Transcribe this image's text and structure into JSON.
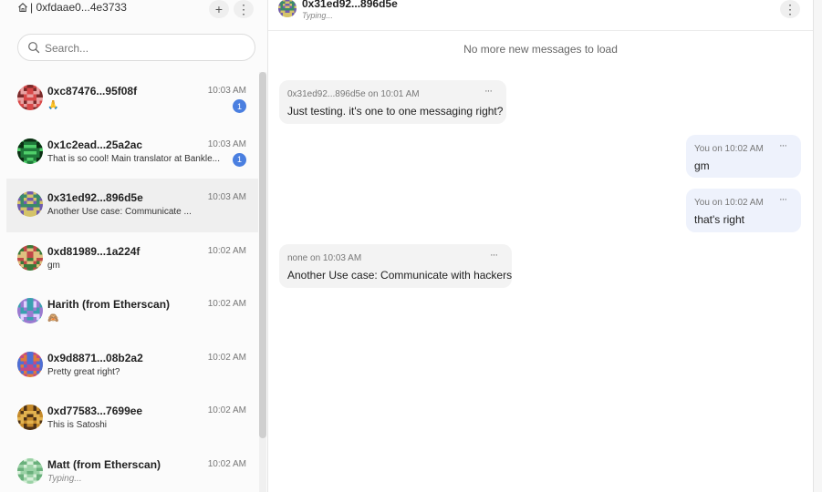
{
  "sidebar": {
    "account": "| 0xfdaae0...4e3733",
    "icons": {
      "home": "home-icon",
      "new": "plus-icon",
      "menu": "kebab-menu-icon"
    },
    "new_label": "+",
    "menu_label": "⋮",
    "search_placeholder": "Search...",
    "conversations": [
      {
        "name": "0xc87476...95f08f",
        "preview": "🙏",
        "time": "10:03 AM",
        "unread": "1"
      },
      {
        "name": "0x1c2ead...25a2ac",
        "preview": "That is so cool! Main translator at Bankle...",
        "time": "10:03 AM",
        "unread": "1"
      },
      {
        "name": "0x31ed92...896d5e",
        "preview": "Another Use case: Communicate ...",
        "time": "10:03 AM",
        "active": true
      },
      {
        "name": "0xd81989...1a224f",
        "preview": "gm",
        "time": "10:02 AM"
      },
      {
        "name": "Harith (from Etherscan)",
        "preview": "🙈",
        "time": "10:02 AM"
      },
      {
        "name": "0x9d8871...08b2a2",
        "preview": "Pretty great right?",
        "time": "10:02 AM"
      },
      {
        "name": "0xd77583...7699ee",
        "preview": "This is Satoshi",
        "time": "10:02 AM"
      },
      {
        "name": "Matt (from Etherscan)",
        "preview": "Typing...",
        "time": "10:02 AM"
      }
    ]
  },
  "chat": {
    "header_name": "0x31ed92...896d5e",
    "header_status": "Typing...",
    "menu_label": "⋮",
    "no_more_text": "No more new messages to load",
    "messages": [
      {
        "direction": "in",
        "meta": "0x31ed92...896d5e on 10:01 AM",
        "text": "Just testing. it's one to one messaging right?",
        "more": "···"
      },
      {
        "direction": "out",
        "meta": "You on 10:02 AM",
        "text": "gm",
        "more": "···"
      },
      {
        "direction": "out",
        "meta": "You on 10:02 AM",
        "text": "that's right",
        "more": "···"
      },
      {
        "direction": "in",
        "meta": "none on 10:03 AM",
        "text": "Another Use case: Communicate with hackers",
        "more": "···"
      }
    ]
  },
  "colors": {
    "unread_badge": "#4a7fe0",
    "outgoing_bubble": "#eef2fc",
    "incoming_bubble": "#f3f3f3"
  }
}
